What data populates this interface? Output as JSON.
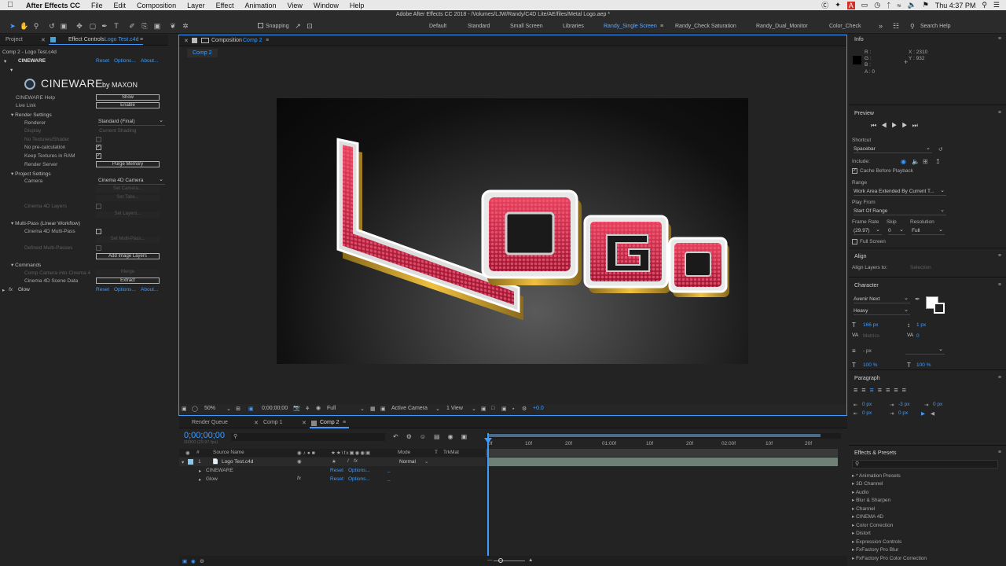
{
  "menubar": {
    "app_name": "After Effects CC",
    "items": [
      "File",
      "Edit",
      "Composition",
      "Layer",
      "Effect",
      "Animation",
      "View",
      "Window",
      "Help"
    ],
    "clock": "Thu 4:37 PM"
  },
  "window_title": "Adobe After Effects CC 2018 - /Volumes/LJW/Randy/C4D Lite/AE/files/Metal Logo.aep *",
  "toolbar": {
    "snapping_label": "Snapping",
    "workspaces": [
      "Default",
      "Standard",
      "Small Screen",
      "Libraries",
      "Randy_Single Screen",
      "Randy_Check Saturation",
      "Randy_Dual_Monitor",
      "Color_Check"
    ],
    "active_workspace": "Randy_Single Screen",
    "search_placeholder": "Search Help"
  },
  "left_panel": {
    "tab_project": "Project",
    "tab_effect_prefix": "Effect Controls",
    "tab_effect_target": "Logo Test.c4d",
    "breadcrumb": "Comp 2 - Logo Test.c4d",
    "cineware": {
      "name": "CINEWARE",
      "reset": "Reset",
      "options": "Options...",
      "about": "About...",
      "logo_text": "CINEWARE",
      "logo_by": "by MAXON",
      "help_label": "CINEWARE Help",
      "help_btn": "Show",
      "live_link_label": "Live Link",
      "live_link_btn": "Enable",
      "render_settings": "Render Settings",
      "renderer_label": "Renderer",
      "renderer_value": "Standard (Final)",
      "display_label": "Display",
      "display_value": "Current Shading",
      "no_textures_label": "No Textures/Shader",
      "no_precalc_label": "No pre-calculation",
      "keep_textures_label": "Keep Textures in RAM",
      "render_server_label": "Render Server",
      "purge_btn": "Purge Memory",
      "project_settings": "Project Settings",
      "camera_label": "Camera",
      "camera_value": "Cinema 4D Camera",
      "set_camera": "Set Camera...",
      "set_take": "Set Take...",
      "c4d_layers_label": "Cinema 4D Layers",
      "set_layers": "Set Layers...",
      "multipass_section": "Multi-Pass (Linear Workflow)",
      "c4d_multipass_label": "Cinema 4D Multi-Pass",
      "set_multipass": "Set Multi-Pass...",
      "defined_multipass_label": "Defined Multi-Passes",
      "add_image_layers": "Add Image Layers",
      "commands": "Commands",
      "comp_camera_label": "Comp Camera into Cinema 4",
      "merge_btn": "Merge",
      "scene_data_label": "Cinema 4D Scene Data",
      "extract_btn": "Extract"
    },
    "glow": {
      "fx": "fx",
      "name": "Glow",
      "reset": "Reset",
      "options": "Options...",
      "about": "About..."
    }
  },
  "composition": {
    "tab_prefix": "Composition",
    "tab_name": "Comp 2",
    "subtab": "Comp 2",
    "logo_text": "LOGO",
    "footer": {
      "zoom": "50%",
      "timecode": "0;00;00;00",
      "resolution": "Full",
      "camera": "Active Camera",
      "view": "1 View",
      "exposure": "+0.0"
    }
  },
  "info": {
    "title": "Info",
    "r": "R :",
    "g": "G :",
    "b": "B :",
    "a": "A : 0",
    "x": "X : 2310",
    "y": "Y : 932"
  },
  "preview": {
    "title": "Preview",
    "shortcut_label": "Shortcut",
    "shortcut_value": "Spacebar",
    "include_label": "Include:",
    "cache_label": "Cache Before Playback",
    "range_label": "Range",
    "range_value": "Work Area Extended By Current T...",
    "play_from_label": "Play From",
    "play_from_value": "Start Of Range",
    "frame_rate_label": "Frame Rate",
    "skip_label": "Skip",
    "resolution_label": "Resolution",
    "frame_rate_value": "(29.97)",
    "skip_value": "0",
    "resolution_value": "Full",
    "full_screen_label": "Full Screen"
  },
  "align": {
    "title": "Align",
    "align_to_label": "Align Layers to:",
    "align_to_value": "Selection"
  },
  "character": {
    "title": "Character",
    "font": "Avenir Next",
    "style": "Heavy",
    "size": "166 px",
    "leading": "1 px",
    "kerning": "Metrics",
    "tracking": "0",
    "stroke": "- px",
    "vscale": "100 %",
    "hscale": "100 %"
  },
  "paragraph": {
    "title": "Paragraph",
    "indent1": "0 px",
    "indent2": "-3 px",
    "indent3": "0 px",
    "space1": "0 px",
    "space2": "0 px"
  },
  "effects": {
    "title": "Effects & Presets",
    "search_placeholder": "",
    "items": [
      "* Animation Presets",
      "3D Channel",
      "Audio",
      "Blur & Sharpen",
      "Channel",
      "CINEMA 4D",
      "Color Correction",
      "Distort",
      "Expression Controls",
      "FxFactory Pro Blur",
      "FxFactory Pro Color Correction"
    ]
  },
  "timeline": {
    "tab_render": "Render Queue",
    "tab_comp1": "Comp 1",
    "tab_comp2": "Comp 2",
    "timecode": "0;00;00;00",
    "fps": "00000 (29.97 fps)",
    "col_num": "#",
    "col_source": "Source Name",
    "col_mode": "Mode",
    "col_t": "T",
    "col_trkmat": "TrkMat",
    "ruler": [
      "0f",
      "10f",
      "20f",
      "01:00f",
      "10f",
      "20f",
      "02:00f",
      "10f",
      "20f"
    ],
    "layer_num": "1",
    "layer_name": "Logo Test.c4d",
    "layer_mode": "Normal",
    "fx_rows": [
      {
        "name": "CINEWARE",
        "reset": "Reset",
        "options": "Options..."
      },
      {
        "name": "Glow",
        "reset": "Reset",
        "options": "Options..."
      }
    ]
  },
  "colors": {
    "accent": "#3f9bff",
    "logo_red": "#c8203c",
    "track": "#6f8077"
  }
}
